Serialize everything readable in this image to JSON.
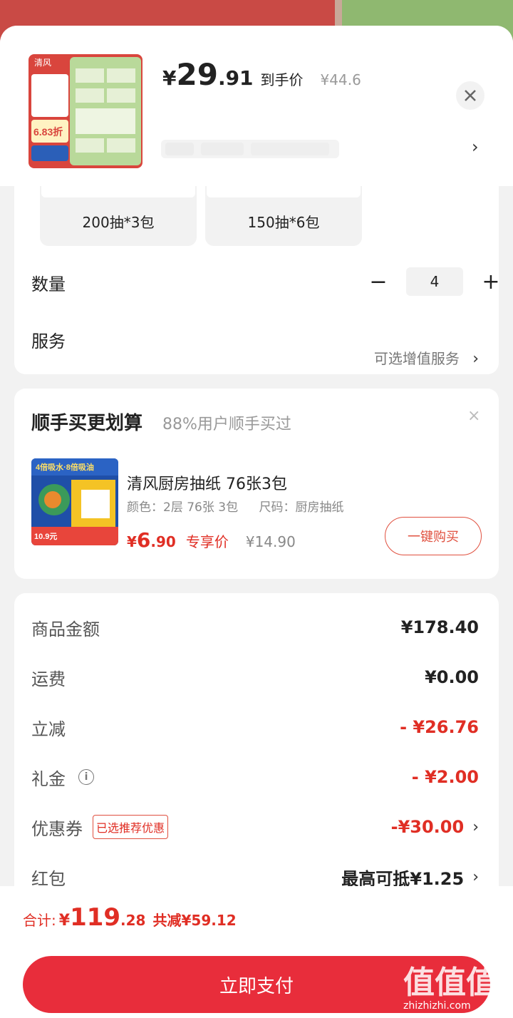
{
  "header": {
    "price_currency": "¥",
    "price_int": "29",
    "price_dec": ".91",
    "price_label": "到手价",
    "original_price": "¥44.6",
    "close_icon": "close-icon",
    "spec_arrow": "›",
    "thumb_brand": "清风",
    "thumb_badge": "6.83折"
  },
  "specs": {
    "options": [
      {
        "label": "200抽*3包"
      },
      {
        "label": "150抽*6包"
      }
    ],
    "quantity_label": "数量",
    "quantity_value": "4",
    "minus": "−",
    "plus": "+",
    "service_label": "服务",
    "service_value": "可选增值服务",
    "arrow": "›"
  },
  "addon": {
    "title": "顺手买更划算",
    "subtitle": "88%用户顺手买过",
    "close": "×",
    "product_name": "清风厨房抽纸 76张3包",
    "color_attr": "颜色：2层 76张 3包",
    "size_attr": "尺码：厨房抽纸",
    "price_currency": "¥",
    "price_int": "6",
    "price_dec": ".90",
    "price_tag": "专享价",
    "original_price": "¥14.90",
    "buy_button": "一键购买",
    "img_text": "4倍吸水·8倍吸油",
    "img_badge": "10.9元"
  },
  "summary": {
    "rows": [
      {
        "label": "商品金额",
        "value": "¥178.40"
      },
      {
        "label": "运费",
        "value": "¥0.00"
      },
      {
        "label": "立减",
        "value": "- ¥26.76"
      },
      {
        "label": "礼金",
        "value": "- ¥2.00"
      },
      {
        "label": "优惠券",
        "value": "-¥30.00",
        "tag": "已选推荐优惠"
      },
      {
        "label": "红包",
        "value": "最高可抵¥1.25"
      }
    ],
    "info_icon": "i",
    "arrow": "›"
  },
  "bottom": {
    "total_label": "合计:",
    "total_currency": "¥",
    "total_int": "119",
    "total_dec": ".28",
    "total_saved": "共减¥59.12",
    "pay_button": "立即支付",
    "watermark": "zhizhizhi.com",
    "watermark_logo": "值值值"
  },
  "colors": {
    "accent_red": "#e02e24",
    "pay_button": "#e82d3b"
  }
}
